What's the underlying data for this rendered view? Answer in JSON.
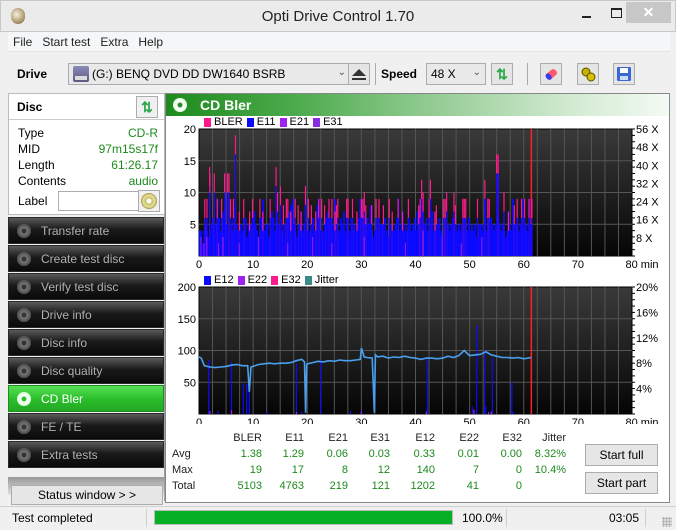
{
  "window": {
    "title": "Opti Drive Control 1.70",
    "minimize": "minimize",
    "maximize": "maximize",
    "close": "✕"
  },
  "menu": [
    "File",
    "Start test",
    "Extra",
    "Help"
  ],
  "toolbar": {
    "drive_label": "Drive",
    "drive_value": "(G:)   BENQ DVD DD DW1640 BSRB",
    "speed_label": "Speed",
    "speed_value": "48 X",
    "icons": [
      "eject-icon",
      "refresh-icon",
      "eraser-icon",
      "settings-gears-icon",
      "save-icon"
    ]
  },
  "disc": {
    "title": "Disc",
    "rows": [
      {
        "key": "Type",
        "value": "CD-R"
      },
      {
        "key": "MID",
        "value": "97m15s17f"
      },
      {
        "key": "Length",
        "value": "61:26.17"
      },
      {
        "key": "Contents",
        "value": "audio"
      }
    ],
    "label_key": "Label",
    "label_value": ""
  },
  "nav": [
    {
      "label": "Transfer rate",
      "active": false
    },
    {
      "label": "Create test disc",
      "active": false
    },
    {
      "label": "Verify test disc",
      "active": false
    },
    {
      "label": "Drive info",
      "active": false
    },
    {
      "label": "Disc info",
      "active": false
    },
    {
      "label": "Disc quality",
      "active": false
    },
    {
      "label": "CD Bler",
      "active": true
    },
    {
      "label": "FE / TE",
      "active": false
    },
    {
      "label": "Extra tests",
      "active": false
    }
  ],
  "status_window_label": "Status window > >",
  "main": {
    "title": "CD Bler"
  },
  "chart_data": [
    {
      "type": "bar",
      "title": "BLER / E11 / E21 / E31",
      "legend": [
        {
          "name": "BLER",
          "color": "#ff1a8c"
        },
        {
          "name": "E11",
          "color": "#0a0aff"
        },
        {
          "name": "E21",
          "color": "#a020f0"
        },
        {
          "name": "E31",
          "color": "#8a2be2"
        }
      ],
      "legend_position": "top-left",
      "xlabel": "min",
      "xlim": [
        0,
        80
      ],
      "x_ticks": [
        "0",
        "10",
        "20",
        "30",
        "40",
        "50",
        "60",
        "70",
        "80 min"
      ],
      "ylim": [
        0,
        20
      ],
      "y_ticks": [
        "5",
        "10",
        "15",
        "20"
      ],
      "y2_ticks": [
        "8 X",
        "16 X",
        "24 X",
        "32 X",
        "40 X",
        "48 X",
        "56 X"
      ],
      "y2lim": [
        0,
        56
      ],
      "end_marker_x": 61.4,
      "end_marker_color": "#ff2020",
      "grid": true,
      "series": {
        "E11_base": [
          4,
          4,
          2,
          4,
          5,
          4,
          3,
          4,
          5,
          6,
          4,
          5,
          9,
          6,
          4,
          5,
          7,
          9,
          5,
          4,
          3,
          5,
          4,
          5,
          8,
          5,
          4,
          3,
          5,
          4,
          4,
          6,
          3,
          5,
          4,
          5,
          6,
          7,
          5,
          4,
          3,
          4,
          6,
          9,
          4,
          5,
          5,
          3,
          4,
          7,
          6,
          4,
          5,
          4,
          5,
          6,
          4,
          3,
          5,
          4,
          6,
          7,
          8,
          9,
          5,
          4,
          3,
          4,
          5,
          7,
          4,
          5,
          9,
          4,
          3,
          4,
          5,
          6,
          4,
          5,
          8,
          9,
          4,
          3,
          4,
          5,
          6,
          7,
          5,
          6,
          4,
          5,
          9,
          4,
          3,
          4,
          6,
          5,
          7,
          4,
          5,
          3,
          4,
          6,
          4,
          5,
          4,
          5,
          6,
          9,
          5,
          4,
          5,
          4,
          6,
          5,
          8,
          4,
          3,
          4,
          5,
          6,
          4,
          5,
          5,
          4,
          6,
          4,
          3,
          4,
          5,
          4,
          4,
          5,
          6,
          9,
          4,
          5,
          7,
          4,
          5,
          4,
          6,
          5,
          4,
          5,
          6,
          4,
          7,
          8,
          4,
          5,
          4,
          5,
          6,
          4,
          4,
          5,
          7,
          4,
          5,
          4,
          5,
          6,
          4,
          3,
          5,
          4,
          4,
          5,
          4,
          5,
          6,
          4,
          5,
          4,
          5,
          4,
          5,
          3,
          4,
          5,
          4,
          6,
          4,
          5,
          4,
          5,
          3,
          4,
          5,
          5,
          4,
          5,
          9,
          4,
          5,
          4,
          6,
          5,
          4,
          5,
          4,
          6,
          5,
          4,
          5,
          4,
          3,
          4,
          7,
          5,
          4,
          9,
          4,
          5,
          6,
          4,
          5,
          4,
          9,
          4,
          5,
          4,
          9,
          5
        ],
        "BLER_peaks": [
          [
            3.5,
            9
          ],
          [
            5,
            9
          ],
          [
            6.8,
            14
          ],
          [
            7,
            13
          ],
          [
            10,
            13
          ],
          [
            12,
            9
          ],
          [
            15,
            9
          ],
          [
            17,
            13
          ],
          [
            19,
            13
          ],
          [
            20,
            13
          ],
          [
            21,
            9
          ],
          [
            23,
            9
          ],
          [
            24.4,
            19
          ],
          [
            27,
            7
          ],
          [
            30,
            9
          ],
          [
            34,
            7
          ],
          [
            36,
            9
          ],
          [
            41,
            9
          ],
          [
            43,
            7
          ],
          [
            48,
            9
          ],
          [
            52,
            14
          ],
          [
            53,
            10
          ],
          [
            55,
            11
          ],
          [
            57,
            8
          ],
          [
            59,
            9
          ],
          [
            60,
            9
          ],
          [
            62,
            7
          ],
          [
            65,
            9
          ],
          [
            67,
            8
          ],
          [
            69,
            7
          ],
          [
            72,
            11
          ],
          [
            74,
            9
          ],
          [
            76,
            8
          ],
          [
            79,
            7
          ],
          [
            81,
            9
          ],
          [
            83,
            9
          ],
          [
            85,
            8
          ],
          [
            88,
            9
          ],
          [
            90,
            9
          ],
          [
            92,
            7
          ],
          [
            93,
            8
          ],
          [
            94,
            9
          ],
          [
            100,
            9
          ],
          [
            101,
            9
          ],
          [
            104,
            9
          ],
          [
            107,
            7
          ],
          [
            110,
            9
          ],
          [
            111,
            9
          ],
          [
            112,
            10
          ],
          [
            113,
            8
          ],
          [
            117,
            8
          ],
          [
            120,
            9
          ],
          [
            122,
            9
          ],
          [
            125,
            8
          ],
          [
            129,
            9
          ],
          [
            131,
            7
          ],
          [
            135,
            9
          ],
          [
            138,
            7
          ],
          [
            142,
            9
          ],
          [
            149,
            8
          ],
          [
            150,
            9
          ],
          [
            151,
            12
          ],
          [
            152,
            10
          ],
          [
            156,
            9
          ],
          [
            157,
            12
          ],
          [
            160,
            7
          ],
          [
            161,
            8
          ],
          [
            166,
            9
          ],
          [
            167,
            9
          ],
          [
            168,
            10
          ],
          [
            173,
            10
          ],
          [
            174,
            8
          ],
          [
            179,
            9
          ],
          [
            180,
            9
          ],
          [
            181,
            9
          ],
          [
            189,
            9
          ],
          [
            194,
            12
          ],
          [
            196,
            9
          ],
          [
            197,
            9
          ],
          [
            202,
            16
          ],
          [
            203,
            16
          ],
          [
            207,
            10
          ],
          [
            210,
            7
          ],
          [
            214,
            8
          ],
          [
            216,
            9
          ],
          [
            219,
            9
          ],
          [
            221,
            9
          ],
          [
            224,
            9
          ],
          [
            226,
            9
          ]
        ]
      },
      "note": "Per-sample bar values estimated; E11 bars 2-9 with peaks, BLER spikes up to 19 at ~15 min; test ends at ~61.4 min"
    },
    {
      "type": "bar",
      "title": "E12 / E22 / E32 / Jitter",
      "legend": [
        {
          "name": "E12",
          "color": "#0a0aff"
        },
        {
          "name": "E22",
          "color": "#a020f0"
        },
        {
          "name": "E32",
          "color": "#ff1a8c"
        },
        {
          "name": "Jitter",
          "color": "#3a8a8a"
        }
      ],
      "legend_position": "top-left",
      "xlabel": "min",
      "xlim": [
        0,
        80
      ],
      "x_ticks": [
        "0",
        "10",
        "20",
        "30",
        "40",
        "50",
        "60",
        "70",
        "80 min"
      ],
      "ylim": [
        0,
        200
      ],
      "y_ticks": [
        "50",
        "100",
        "150",
        "200"
      ],
      "y2lim": [
        0,
        20
      ],
      "y2_ticks": [
        "4%",
        "8%",
        "12%",
        "16%",
        "20%"
      ],
      "end_marker_x": 61.4,
      "end_marker_color": "#ff2020",
      "grid": true,
      "e12_spikes": [
        [
          1.8,
          85
        ],
        [
          3.5,
          5
        ],
        [
          6,
          82
        ],
        [
          8.2,
          48
        ],
        [
          8.8,
          47
        ],
        [
          9.3,
          38
        ],
        [
          12.5,
          4
        ],
        [
          18,
          80
        ],
        [
          19,
          4
        ],
        [
          22.5,
          85
        ],
        [
          28,
          5
        ],
        [
          30,
          5
        ],
        [
          42.2,
          88
        ],
        [
          50.5,
          12
        ],
        [
          51.3,
          140
        ],
        [
          52.8,
          100
        ],
        [
          53,
          12
        ],
        [
          54.2,
          88
        ],
        [
          57.8,
          50
        ],
        [
          58,
          3
        ]
      ],
      "e22_spikes": [
        [
          2,
          5
        ],
        [
          6,
          6
        ],
        [
          18,
          3
        ],
        [
          30,
          4
        ],
        [
          42,
          4
        ],
        [
          50.8,
          7
        ],
        [
          53.5,
          3
        ],
        [
          54,
          4
        ]
      ],
      "jitter_pct": [
        [
          0,
          9.0
        ],
        [
          0.4,
          8.8
        ],
        [
          1,
          7.6
        ],
        [
          2,
          7.4
        ],
        [
          3,
          7.3
        ],
        [
          4,
          7.4
        ],
        [
          5,
          7.5
        ],
        [
          6,
          7.7
        ],
        [
          7,
          7.8
        ],
        [
          8,
          7.6
        ],
        [
          9,
          7.6
        ],
        [
          9.3,
          3.5
        ],
        [
          9.6,
          7.4
        ],
        [
          10,
          7.5
        ],
        [
          11,
          7.8
        ],
        [
          12,
          7.9
        ],
        [
          13,
          8.0
        ],
        [
          14,
          7.9
        ],
        [
          15,
          8.0
        ],
        [
          16,
          8.0
        ],
        [
          17,
          8.1
        ],
        [
          18,
          8.4
        ],
        [
          19,
          8.6
        ],
        [
          19.5,
          8.2
        ],
        [
          19.7,
          0.2
        ],
        [
          19.9,
          7.8
        ],
        [
          20,
          7.9
        ],
        [
          21,
          8.1
        ],
        [
          22,
          8.3
        ],
        [
          23,
          8.2
        ],
        [
          24,
          8.4
        ],
        [
          25,
          8.3
        ],
        [
          26,
          8.5
        ],
        [
          27,
          8.4
        ],
        [
          28,
          8.4
        ],
        [
          29,
          8.5
        ],
        [
          29.8,
          8.6
        ],
        [
          30,
          10.4
        ],
        [
          30.5,
          9.0
        ],
        [
          31,
          8.9
        ],
        [
          32,
          8.8
        ],
        [
          32.4,
          0.2
        ],
        [
          32.6,
          9.3
        ],
        [
          33,
          9.0
        ],
        [
          34,
          9.1
        ],
        [
          35,
          8.8
        ],
        [
          36,
          9.0
        ],
        [
          37,
          8.9
        ],
        [
          38,
          9.1
        ],
        [
          39,
          8.9
        ],
        [
          40,
          8.8
        ],
        [
          41,
          8.6
        ],
        [
          42,
          8.8
        ],
        [
          43,
          8.8
        ],
        [
          44,
          8.7
        ],
        [
          45,
          8.8
        ],
        [
          46,
          9.1
        ],
        [
          47,
          8.9
        ],
        [
          48,
          9.2
        ],
        [
          49,
          10.0
        ],
        [
          50,
          9.2
        ],
        [
          51,
          9.3
        ],
        [
          52,
          9.4
        ],
        [
          53,
          9.8
        ],
        [
          54,
          9.3
        ],
        [
          55,
          9.1
        ],
        [
          56,
          8.9
        ],
        [
          57,
          8.9
        ],
        [
          58,
          8.8
        ],
        [
          59,
          8.9
        ],
        [
          60,
          8.7
        ],
        [
          61.4,
          8.9
        ]
      ],
      "note": "Jitter line on right axis (%), E12 spikes on left axis"
    }
  ],
  "stats": {
    "columns": [
      "BLER",
      "E11",
      "E21",
      "E31",
      "E12",
      "E22",
      "E32",
      "Jitter"
    ],
    "rows": [
      {
        "label": "Avg",
        "values": [
          "1.38",
          "1.29",
          "0.06",
          "0.03",
          "0.33",
          "0.01",
          "0.00",
          "8.32%"
        ]
      },
      {
        "label": "Max",
        "values": [
          "19",
          "17",
          "8",
          "12",
          "140",
          "7",
          "0",
          "10.4%"
        ]
      },
      {
        "label": "Total",
        "values": [
          "5103",
          "4763",
          "219",
          "121",
          "1202",
          "41",
          "0",
          ""
        ]
      }
    ]
  },
  "buttons": {
    "start_full": "Start full",
    "start_part": "Start part"
  },
  "statusbar": {
    "text": "Test completed",
    "progress": 100.0,
    "progress_text": "100.0%",
    "elapsed": "03:05"
  }
}
